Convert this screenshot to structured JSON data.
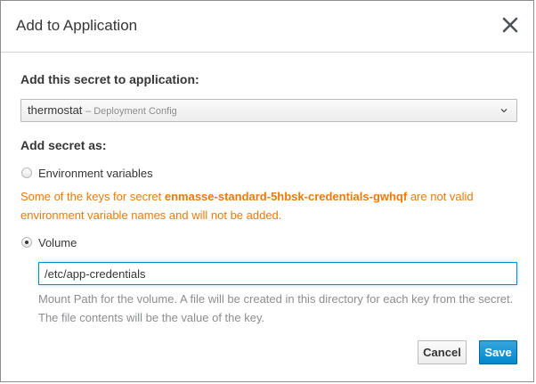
{
  "dialog": {
    "title": "Add to Application",
    "close_icon": "close-icon"
  },
  "application": {
    "label": "Add this secret to application:",
    "select": {
      "name": "thermostat",
      "kind": "– Deployment Config",
      "caret_icon": "chevron-down-icon"
    }
  },
  "add_as": {
    "label": "Add secret as:",
    "options": [
      {
        "label": "Environment variables",
        "selected": false
      },
      {
        "label": "Volume",
        "selected": true
      }
    ],
    "warning": {
      "prefix": "Some of the keys for secret ",
      "secret_name": "enmasse-standard-5hbsk-credentials-gwhqf",
      "suffix": " are not valid environment variable names and will not be added."
    }
  },
  "volume": {
    "mount_path_value": "/etc/app-credentials",
    "help_text": "Mount Path for the volume. A file will be created in this directory for each key from the secret. The file contents will be the value of the key."
  },
  "footer": {
    "cancel_label": "Cancel",
    "save_label": "Save"
  },
  "colors": {
    "warning": "#ec7a08",
    "primary": "#0088ce",
    "help_text": "#8b8d8f",
    "text": "#363636"
  }
}
